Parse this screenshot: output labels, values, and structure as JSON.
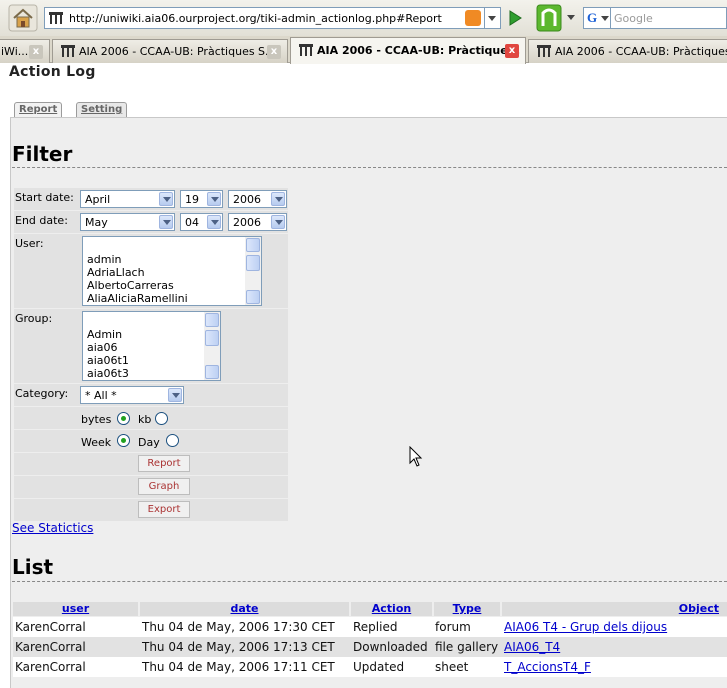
{
  "browser": {
    "url": "http://uniwiki.aia06.ourproject.org/tiki-admin_actionlog.php#Report",
    "search_placeholder": "Google",
    "search_engine_letter": "G",
    "tabs": [
      {
        "label": "iWi...",
        "active": false
      },
      {
        "label": "AIA 2006 - CCAA-UB: Pràctiques S...",
        "active": false
      },
      {
        "label": "AIA 2006 - CCAA-UB: Pràctique...",
        "active": true
      },
      {
        "label": "AIA 2006 - CCAA-UB: Pràctiques S...",
        "active": false
      }
    ]
  },
  "page": {
    "title": "Action Log",
    "subtabs": {
      "report": "Report",
      "setting": "Setting"
    }
  },
  "filter": {
    "heading": "Filter",
    "start_date": {
      "label": "Start date:",
      "month": "April",
      "day": "19",
      "year": "2006"
    },
    "end_date": {
      "label": "End date:",
      "month": "May",
      "day": "04",
      "year": "2006"
    },
    "user": {
      "label": "User:",
      "options": [
        "admin",
        "AdriaLlach",
        "AlbertoCarreras",
        "AliaAliciaRamellini"
      ]
    },
    "group": {
      "label": "Group:",
      "options": [
        "Admin",
        "aia06",
        "aia06t1",
        "aia06t3"
      ]
    },
    "category": {
      "label": "Category:",
      "value": "* All *"
    },
    "unit": {
      "bytes": "bytes",
      "kb": "kb",
      "selected": "bytes"
    },
    "period": {
      "week": "Week",
      "day": "Day",
      "selected": "week"
    },
    "buttons": {
      "report": "Report",
      "graph": "Graph",
      "export": "Export"
    },
    "see_stats": "See Statictics"
  },
  "list": {
    "heading": "List",
    "columns": [
      "user",
      "date",
      "Action",
      "Type",
      "Object"
    ],
    "rows": [
      {
        "user": "KarenCorral",
        "date": "Thu 04 de May, 2006 17:30 CET",
        "action": "Replied",
        "type": "forum",
        "object": "AIA06 T4 - Grup dels dijous"
      },
      {
        "user": "KarenCorral",
        "date": "Thu 04 de May, 2006 17:13 CET",
        "action": "Downloaded",
        "type": "file gallery",
        "object": "AIA06_T4"
      },
      {
        "user": "KarenCorral",
        "date": "Thu 04 de May, 2006 17:11 CET",
        "action": "Updated",
        "type": "sheet",
        "object": "T_AccionsT4_F"
      }
    ]
  },
  "colors": {
    "link": "#0000cc",
    "panel": "#eeeeee",
    "row_alt": "#e2e2e2",
    "close_active": "#e0463f"
  }
}
